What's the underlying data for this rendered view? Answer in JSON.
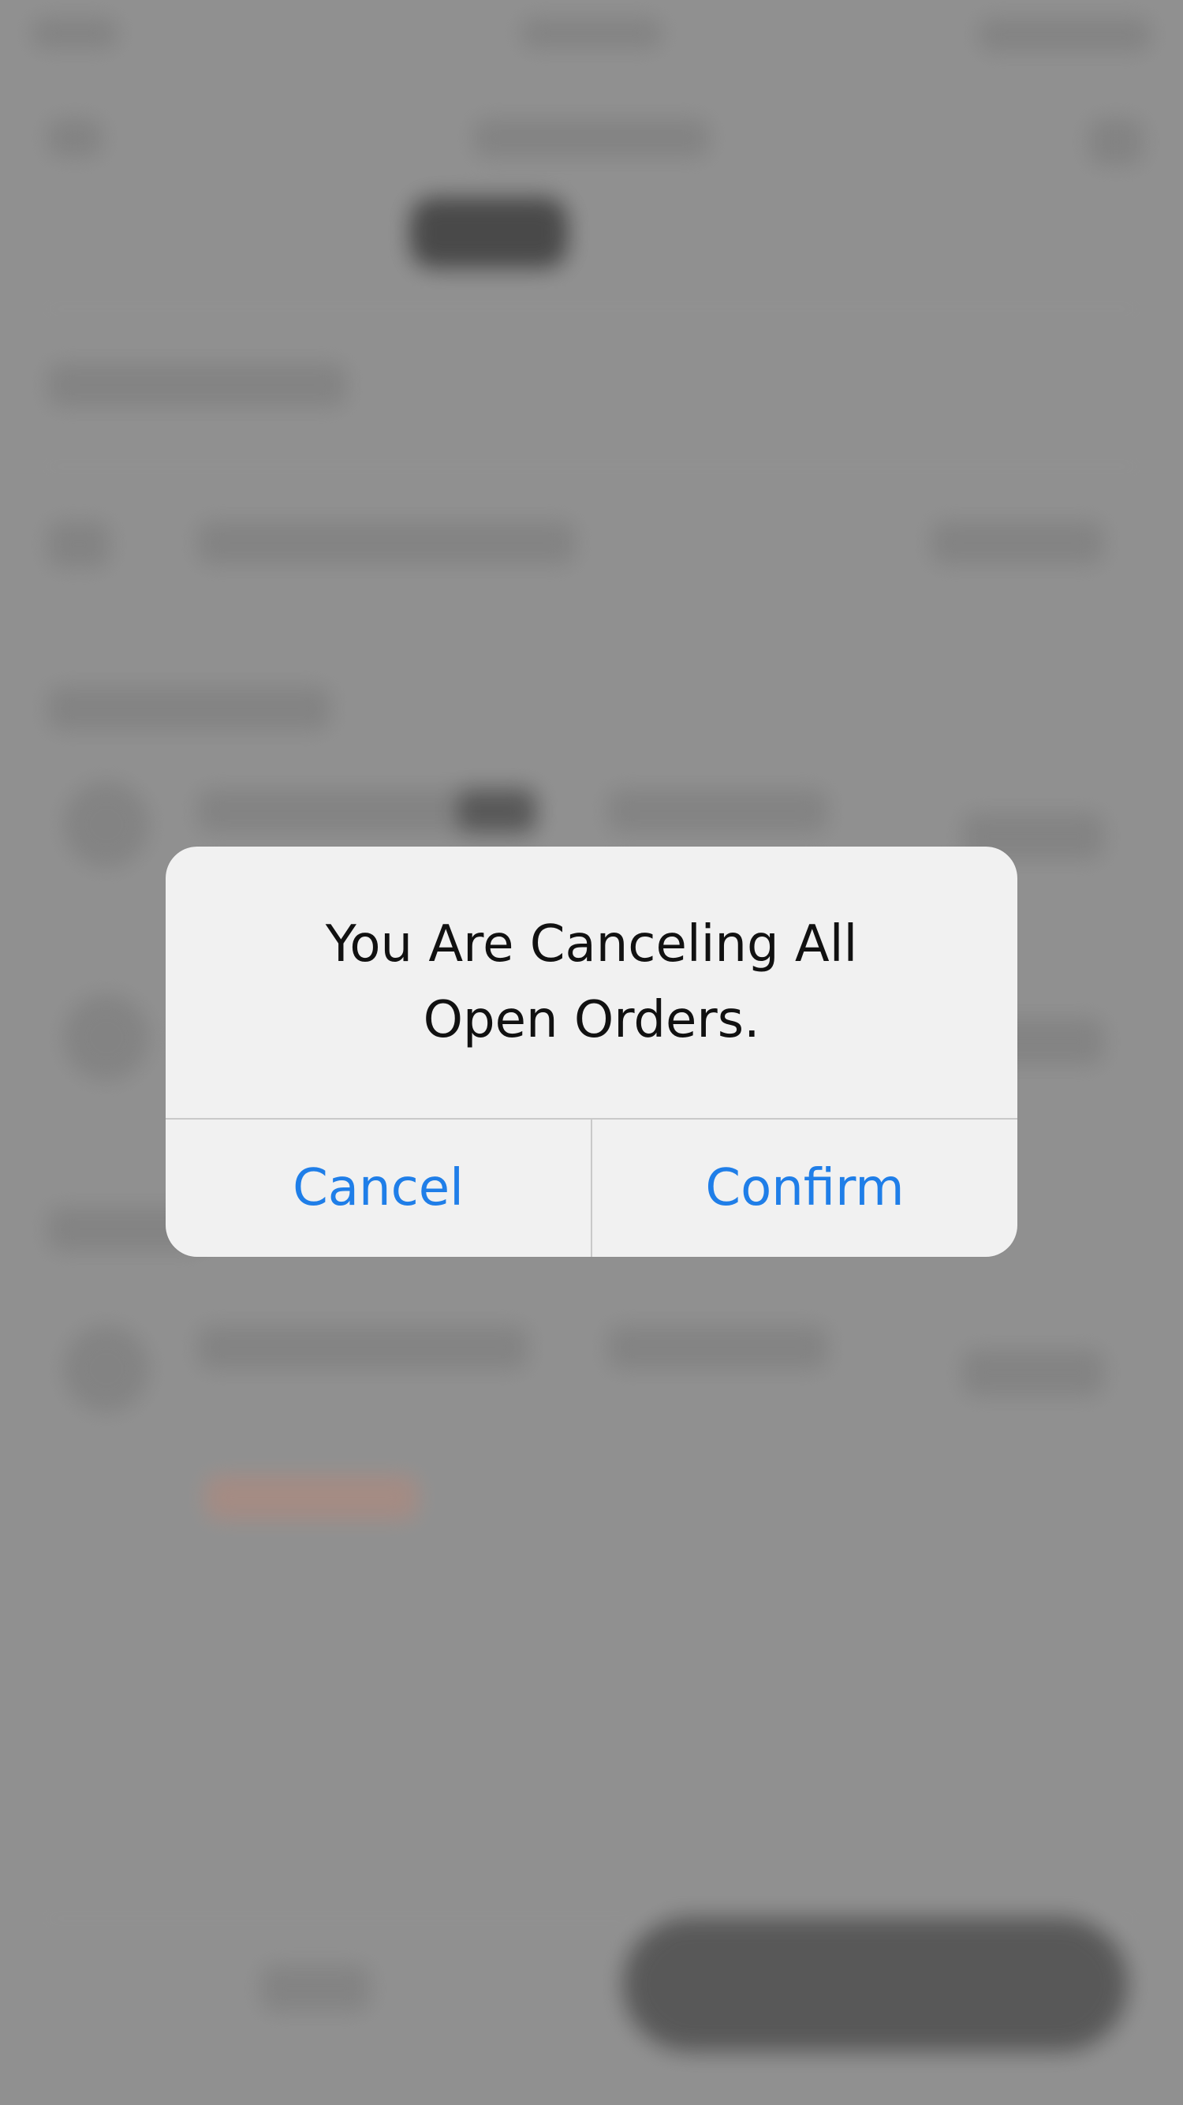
{
  "dialog": {
    "message_line1": "You Are Canceling All",
    "message_line2": "Open Orders.",
    "cancel_label": "Cancel",
    "confirm_label": "Confirm"
  },
  "colors": {
    "backdrop": "#9a9a9a",
    "dialog_background": "#f1f1f1",
    "action_text": "#1f7ee8",
    "message_text": "#111111"
  }
}
